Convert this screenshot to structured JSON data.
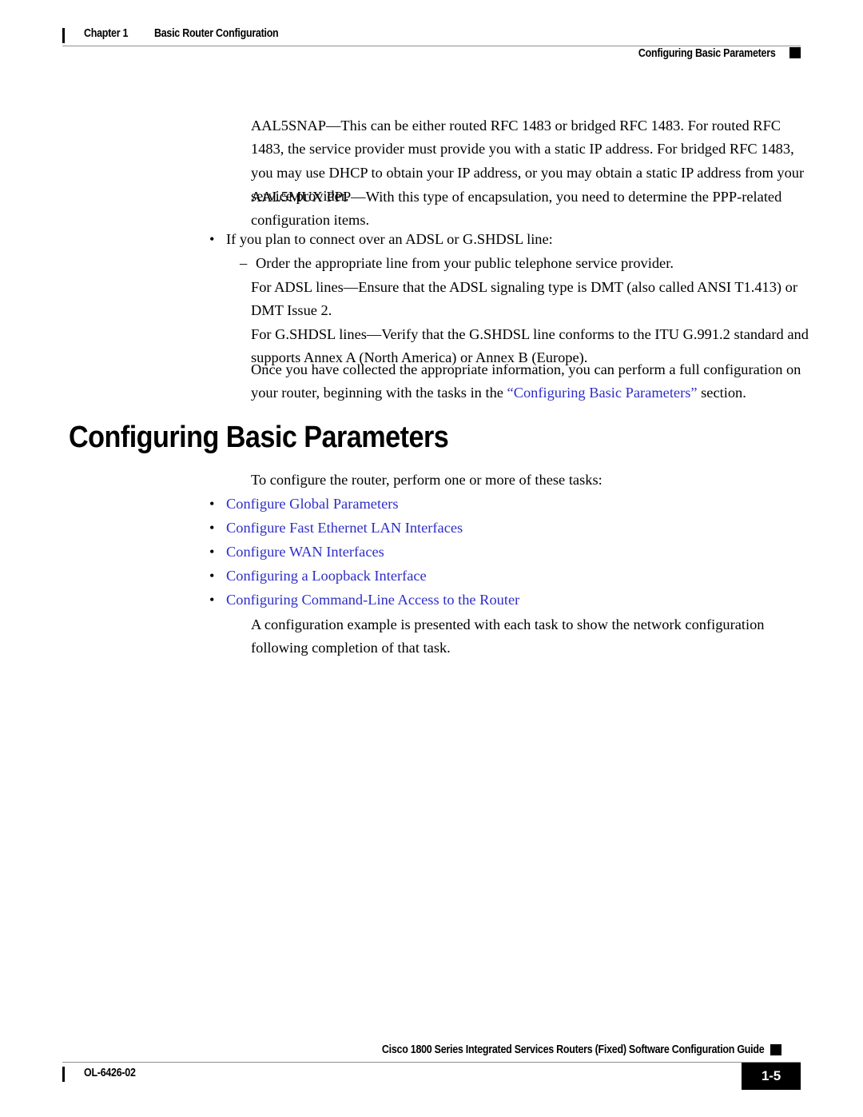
{
  "header": {
    "chapter_label": "Chapter 1",
    "chapter_title": "Basic Router Configuration",
    "section_title": "Configuring Basic Parameters"
  },
  "body": {
    "para_aal5snap": "AAL5SNAP—This can be either routed RFC 1483 or bridged RFC 1483. For routed RFC 1483, the service provider must provide you with a static IP address. For bridged RFC 1483, you may use DHCP to obtain your IP address, or you may obtain a static IP address from your service provider.",
    "para_aal5mux": "AAL5MUX PPP—With this type of encapsulation, you need to determine the PPP-related configuration items.",
    "bullet_mark": "•",
    "dash_mark": "–",
    "bullet_adsl": "If you plan to connect over an ADSL or G.SHDSL line:",
    "dash_order_line": "Order the appropriate line from your public telephone service provider.",
    "para_adsl_lines": "For ADSL lines—Ensure that the ADSL signaling type is DMT (also called ANSI T1.413) or DMT Issue 2.",
    "para_gshdsl_lines": "For G.SHDSL lines—Verify that the G.SHDSL line conforms to the ITU G.991.2 standard and supports Annex A (North America) or Annex B (Europe).",
    "para_once_prefix": "Once you have collected the appropriate information, you can perform a full configuration on your router, beginning with the tasks in the ",
    "para_once_link": "“Configuring Basic Parameters”",
    "para_once_suffix": " section.",
    "heading": "Configuring Basic Parameters",
    "para_intro_tasks": "To configure the router, perform one or more of these tasks:",
    "task_links": [
      "Configure Global Parameters",
      "Configure Fast Ethernet LAN Interfaces",
      "Configure WAN Interfaces",
      "Configuring a Loopback Interface",
      "Configuring Command-Line Access to the Router"
    ],
    "para_example": "A configuration example is presented with each task to show the network configuration following completion of that task."
  },
  "footer": {
    "guide_title": "Cisco 1800 Series Integrated Services Routers (Fixed) Software Configuration Guide",
    "doc_id": "OL-6426-02",
    "page_number": "1-5"
  },
  "colors": {
    "link": "#2d2dc8",
    "rule": "#909090",
    "ink": "#000000"
  }
}
